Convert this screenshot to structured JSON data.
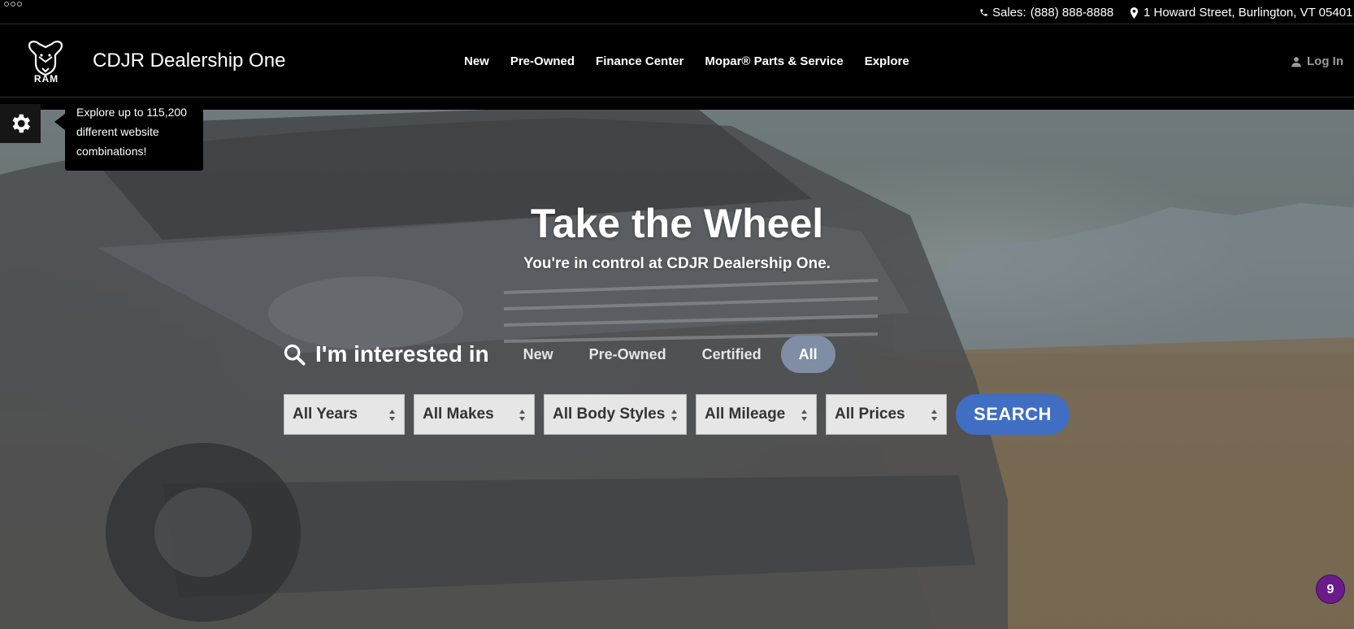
{
  "topbar": {
    "sales_label": "Sales:",
    "sales_phone": "(888) 888-8888",
    "address": "1 Howard Street, Burlington, VT 05401"
  },
  "header": {
    "logo_text": "RAM",
    "brand": "CDJR Dealership One",
    "nav": [
      "New",
      "Pre-Owned",
      "Finance Center",
      "Mopar® Parts & Service",
      "Explore"
    ],
    "login": "Log In"
  },
  "tooltip": {
    "text": "Explore up to 115,200 different website combinations!"
  },
  "hero": {
    "headline": "Take the Wheel",
    "subheadline": "You're in control at CDJR Dealership One."
  },
  "search": {
    "label": "I'm interested in",
    "tabs": [
      "New",
      "Pre-Owned",
      "Certified",
      "All"
    ],
    "active_tab": "All",
    "selects": [
      "All Years",
      "All Makes",
      "All Body Styles",
      "All Mileage",
      "All Prices"
    ],
    "button": "SEARCH"
  },
  "badge": {
    "count": "9"
  },
  "colors": {
    "accent": "#3f6ec2",
    "active_tab": "#7f8ea4",
    "badge": "#6a1b8a"
  },
  "icons": [
    "phone-icon",
    "location-pin-icon",
    "ram-logo",
    "user-icon",
    "gear-icon",
    "search-icon",
    "select-arrows-icon"
  ]
}
